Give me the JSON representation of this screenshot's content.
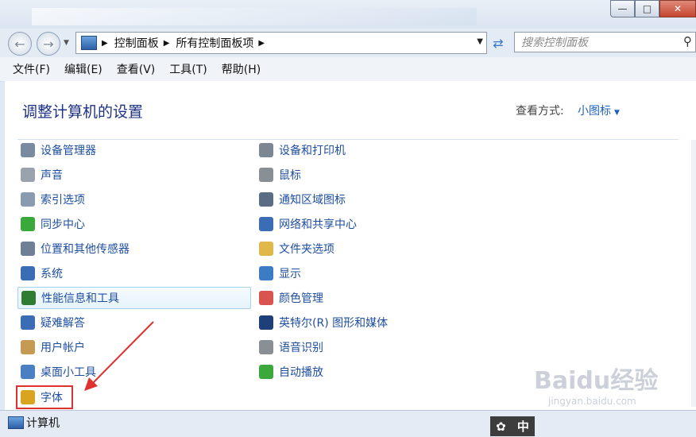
{
  "nav": {
    "back_icon": "back-arrow-icon",
    "forward_icon": "forward-arrow-icon",
    "breadcrumb": [
      "控制面板",
      "所有控制面板项"
    ],
    "search_placeholder": "搜索控制面板"
  },
  "menu": [
    "文件(F)",
    "编辑(E)",
    "查看(V)",
    "工具(T)",
    "帮助(H)"
  ],
  "heading": "调整计算机的设置",
  "view_by_label": "查看方式:",
  "view_by_value": "小图标",
  "left_items": [
    {
      "label": "设备管理器",
      "icon": "device-manager-icon",
      "color": "#7a8aa0"
    },
    {
      "label": "声音",
      "icon": "speaker-icon",
      "color": "#9aa3ad"
    },
    {
      "label": "索引选项",
      "icon": "indexing-icon",
      "color": "#8a9bb0"
    },
    {
      "label": "同步中心",
      "icon": "sync-center-icon",
      "color": "#3aa83a"
    },
    {
      "label": "位置和其他传感器",
      "icon": "sensor-icon",
      "color": "#6f7f96"
    },
    {
      "label": "系统",
      "icon": "system-icon",
      "color": "#3b6db5"
    },
    {
      "label": "性能信息和工具",
      "icon": "performance-icon",
      "color": "#2e7d32"
    },
    {
      "label": "疑难解答",
      "icon": "troubleshoot-icon",
      "color": "#3b6db5"
    },
    {
      "label": "用户帐户",
      "icon": "user-accounts-icon",
      "color": "#c79a54"
    },
    {
      "label": "桌面小工具",
      "icon": "gadgets-icon",
      "color": "#4a7fc4"
    },
    {
      "label": "字体",
      "icon": "fonts-icon",
      "color": "#d9a520"
    }
  ],
  "right_items": [
    {
      "label": "设备和打印机",
      "icon": "printer-icon",
      "color": "#7d8794"
    },
    {
      "label": "鼠标",
      "icon": "mouse-icon",
      "color": "#8a8f96"
    },
    {
      "label": "通知区域图标",
      "icon": "notification-icon",
      "color": "#5b6d84"
    },
    {
      "label": "网络和共享中心",
      "icon": "network-icon",
      "color": "#3b6db5"
    },
    {
      "label": "文件夹选项",
      "icon": "folder-icon",
      "color": "#e0b84a"
    },
    {
      "label": "显示",
      "icon": "display-icon",
      "color": "#3b7cc4"
    },
    {
      "label": "颜色管理",
      "icon": "color-management-icon",
      "color": "#d9534f"
    },
    {
      "label": "英特尔(R) 图形和媒体",
      "icon": "intel-graphics-icon",
      "color": "#1f3f7a"
    },
    {
      "label": "语音识别",
      "icon": "microphone-icon",
      "color": "#8a8f96"
    },
    {
      "label": "自动播放",
      "icon": "autoplay-icon",
      "color": "#3aa83a"
    }
  ],
  "status": "计算机",
  "ime": "中",
  "watermark": {
    "brand": "Baidu经验",
    "url": "jingyan.baidu.com"
  }
}
